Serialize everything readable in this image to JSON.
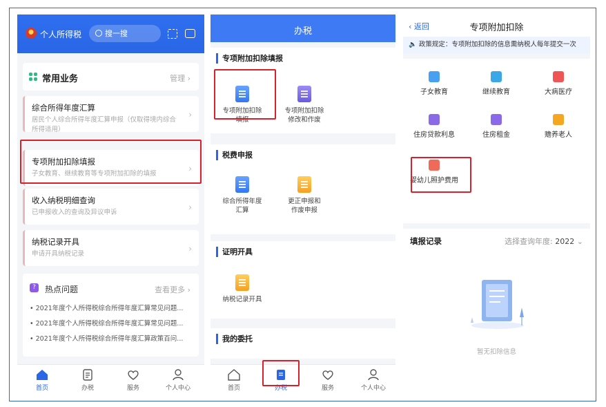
{
  "panel1": {
    "header": {
      "title": "个人所得税",
      "search_placeholder": "搜一搜"
    },
    "common": {
      "title": "常用业务",
      "manage": "管理"
    },
    "business": [
      {
        "title": "综合所得年度汇算",
        "desc": "居民个人综合所得年度汇算申报（仅取得境内综合所得适用）"
      },
      {
        "title": "专项附加扣除填报",
        "desc": "子女教育、继续教育等专项附加扣除的填报"
      },
      {
        "title": "收入纳税明细查询",
        "desc": "已申报收入的查询及异议申诉"
      },
      {
        "title": "纳税记录开具",
        "desc": "申请开具纳税记录"
      }
    ],
    "hot": {
      "title": "热点问题",
      "more": "查看更多",
      "items": [
        "2021年度个人所得税综合所得年度汇算常见问题...",
        "2021年度个人所得税综合所得年度汇算常见问题...",
        "2021年度个人所得税综合所得年度汇算政策百问..."
      ]
    },
    "tabs": [
      "首页",
      "办税",
      "服务",
      "个人中心"
    ]
  },
  "panel2": {
    "header_title": "办税",
    "sections": [
      {
        "title": "专项附加扣除填报",
        "items": [
          "专项附加扣除\n填报",
          "专项附加扣除\n修改和作废"
        ]
      },
      {
        "title": "税费申报",
        "items": [
          "综合所得年度\n汇算",
          "更正申报和\n作废申报"
        ]
      },
      {
        "title": "证明开具",
        "items": [
          "纳税记录开具"
        ]
      },
      {
        "title": "我的委托",
        "items": []
      }
    ],
    "tabs": [
      "首页",
      "办税",
      "服务",
      "个人中心"
    ]
  },
  "panel3": {
    "back": "返回",
    "title": "专项附加扣除",
    "notice": "政策规定：专项附加扣除的信息需纳税人每年提交一次",
    "categories": [
      "子女教育",
      "继续教育",
      "大病医疗",
      "住房贷款利息",
      "住房租金",
      "赡养老人",
      "婴幼儿照护费用"
    ],
    "record": {
      "title": "填报记录",
      "year_label": "选择查询年度:",
      "year": "2022",
      "empty": "暂无扣除信息"
    }
  },
  "colors": {
    "primary": "#2a66e6",
    "highlight": "#d8202a",
    "header": "#3d7af3"
  }
}
